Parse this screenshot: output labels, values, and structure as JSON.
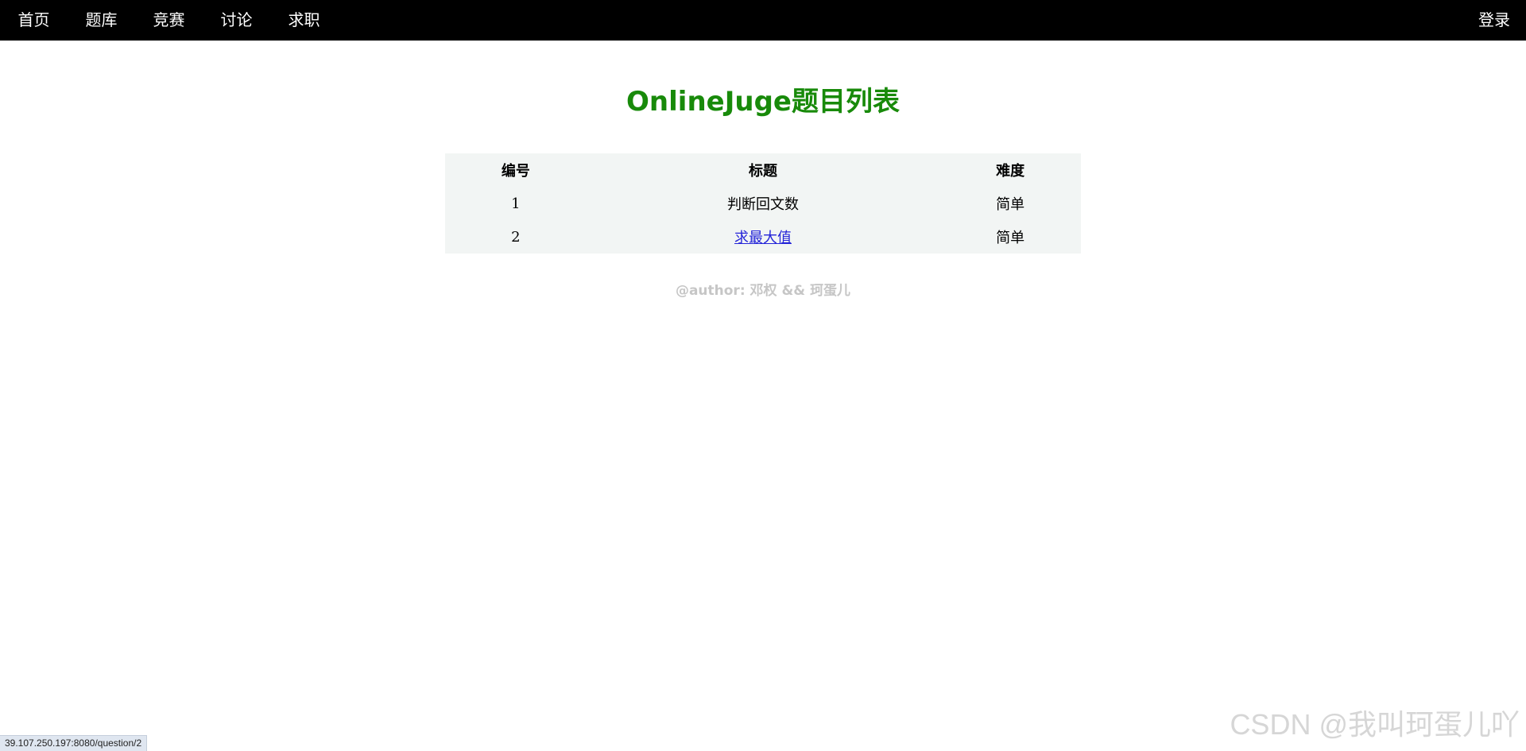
{
  "nav": {
    "items": [
      {
        "label": "首页"
      },
      {
        "label": "题库"
      },
      {
        "label": "竞赛"
      },
      {
        "label": "讨论"
      },
      {
        "label": "求职"
      }
    ],
    "login_label": "登录"
  },
  "page": {
    "title": "OnlineJuge题目列表"
  },
  "table": {
    "headers": [
      "编号",
      "标题",
      "难度"
    ],
    "rows": [
      {
        "id": "1",
        "title": "判断回文数",
        "difficulty": "简单"
      },
      {
        "id": "2",
        "title": "求最大值",
        "difficulty": "简单"
      }
    ]
  },
  "footer": {
    "author": "@author: 邓权 && 珂蛋儿"
  },
  "status_bar": {
    "url": "39.107.250.197:8080/question/2"
  },
  "watermark": {
    "text": "CSDN @我叫珂蛋儿吖"
  },
  "colors": {
    "nav_bg": "#000000",
    "title": "#188a0a",
    "table_bg": "#f2f5f4",
    "link": "#2424d8"
  }
}
